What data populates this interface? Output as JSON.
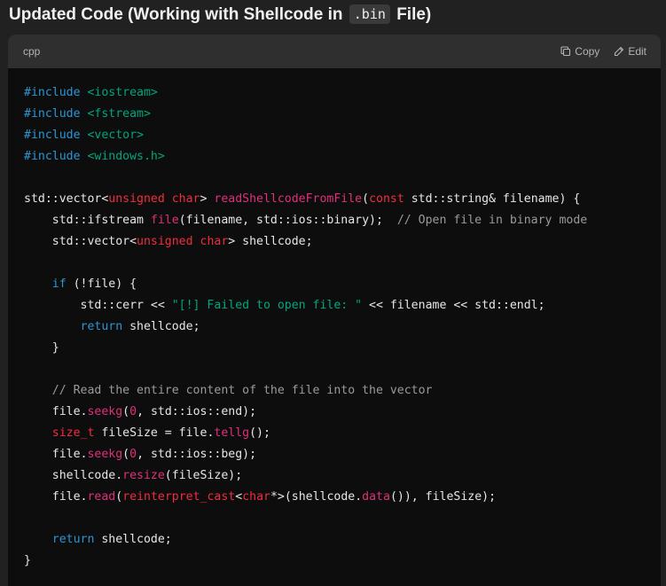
{
  "heading": {
    "before": "Updated Code (Working with Shellcode in",
    "code": ".bin",
    "after": "File)"
  },
  "code_block": {
    "language": "cpp",
    "copy_label": "Copy",
    "edit_label": "Edit",
    "lines": [
      [
        {
          "t": "#include ",
          "c": "k"
        },
        {
          "t": "<iostream>",
          "c": "s"
        }
      ],
      [
        {
          "t": "#include ",
          "c": "k"
        },
        {
          "t": "<fstream>",
          "c": "s"
        }
      ],
      [
        {
          "t": "#include ",
          "c": "k"
        },
        {
          "t": "<vector>",
          "c": "s"
        }
      ],
      [
        {
          "t": "#include ",
          "c": "k"
        },
        {
          "t": "<windows.h>",
          "c": "s"
        }
      ],
      [],
      [
        {
          "t": "std::vector<"
        },
        {
          "t": "unsigned char",
          "c": "t"
        },
        {
          "t": "> "
        },
        {
          "t": "readShellcodeFromFile",
          "c": "f"
        },
        {
          "t": "("
        },
        {
          "t": "const",
          "c": "t"
        },
        {
          "t": " std::string& filename) {"
        }
      ],
      [
        {
          "t": "    std::ifstream "
        },
        {
          "t": "file",
          "c": "f"
        },
        {
          "t": "(filename, std::ios::binary);  "
        },
        {
          "t": "// Open file in binary mode",
          "c": "c"
        }
      ],
      [
        {
          "t": "    std::vector<"
        },
        {
          "t": "unsigned char",
          "c": "t"
        },
        {
          "t": "> shellcode;"
        }
      ],
      [],
      [
        {
          "t": "    "
        },
        {
          "t": "if",
          "c": "k"
        },
        {
          "t": " (!file) {"
        }
      ],
      [
        {
          "t": "        std::cerr << "
        },
        {
          "t": "\"[!] Failed to open file: \"",
          "c": "s"
        },
        {
          "t": " << filename << std::endl;"
        }
      ],
      [
        {
          "t": "        "
        },
        {
          "t": "return",
          "c": "k"
        },
        {
          "t": " shellcode;"
        }
      ],
      [
        {
          "t": "    }"
        }
      ],
      [],
      [
        {
          "t": "    "
        },
        {
          "t": "// Read the entire content of the file into the vector",
          "c": "c"
        }
      ],
      [
        {
          "t": "    file."
        },
        {
          "t": "seekg",
          "c": "f"
        },
        {
          "t": "("
        },
        {
          "t": "0",
          "c": "n"
        },
        {
          "t": ", std::ios::end);"
        }
      ],
      [
        {
          "t": "    "
        },
        {
          "t": "size_t",
          "c": "t"
        },
        {
          "t": " fileSize = file."
        },
        {
          "t": "tellg",
          "c": "f"
        },
        {
          "t": "();"
        }
      ],
      [
        {
          "t": "    file."
        },
        {
          "t": "seekg",
          "c": "f"
        },
        {
          "t": "("
        },
        {
          "t": "0",
          "c": "n"
        },
        {
          "t": ", std::ios::beg);"
        }
      ],
      [
        {
          "t": "    shellcode."
        },
        {
          "t": "resize",
          "c": "f"
        },
        {
          "t": "(fileSize);"
        }
      ],
      [
        {
          "t": "    file."
        },
        {
          "t": "read",
          "c": "f"
        },
        {
          "t": "("
        },
        {
          "t": "reinterpret_cast",
          "c": "t"
        },
        {
          "t": "<"
        },
        {
          "t": "char",
          "c": "t"
        },
        {
          "t": "*>(shellcode."
        },
        {
          "t": "data",
          "c": "f"
        },
        {
          "t": "()), fileSize);"
        }
      ],
      [],
      [
        {
          "t": "    "
        },
        {
          "t": "return",
          "c": "k"
        },
        {
          "t": " shellcode;"
        }
      ],
      [
        {
          "t": "}"
        }
      ]
    ]
  }
}
